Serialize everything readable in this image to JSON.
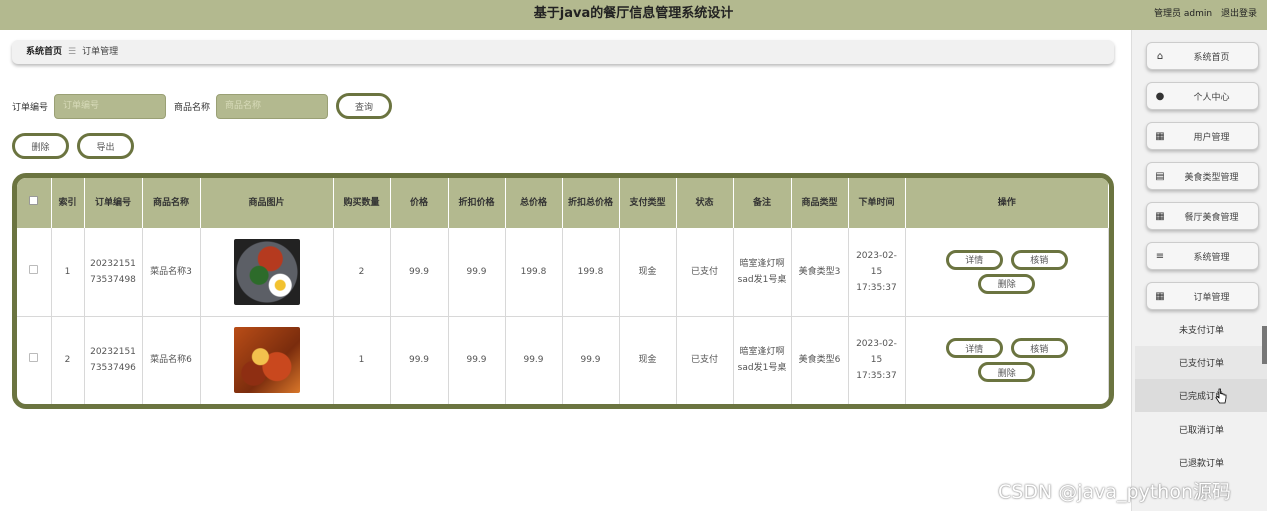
{
  "header": {
    "title": "基于java的餐厅信息管理系统设计",
    "admin_label": "管理员 admin",
    "logout_label": "退出登录"
  },
  "breadcrumb": {
    "home": "系统首页",
    "current": "订单管理"
  },
  "search": {
    "order_no_label": "订单编号",
    "order_no_placeholder": "订单编号",
    "product_name_label": "商品名称",
    "product_name_placeholder": "商品名称",
    "query_button": "查询"
  },
  "actions": {
    "delete_button": "删除",
    "export_button": "导出"
  },
  "table": {
    "columns": [
      "索引",
      "订单编号",
      "商品名称",
      "商品图片",
      "购买数量",
      "价格",
      "折扣价格",
      "总价格",
      "折扣总价格",
      "支付类型",
      "状态",
      "备注",
      "商品类型",
      "下单时间",
      "操作"
    ],
    "rows": [
      {
        "index": "1",
        "order_no": "2023215173537498",
        "product_name": "菜品名称3",
        "image_icon": "food-photo-icon",
        "quantity": "2",
        "price": "99.9",
        "discount_price": "99.9",
        "total_price": "199.8",
        "discount_total": "199.8",
        "pay_type": "现金",
        "status": "已支付",
        "remark": "暗室逢灯啊sad发1号桌",
        "product_type": "美食类型3",
        "order_time": "2023-02-15 17:35:37"
      },
      {
        "index": "2",
        "order_no": "2023215173537496",
        "product_name": "菜品名称6",
        "image_icon": "food-photo-icon",
        "quantity": "1",
        "price": "99.9",
        "discount_price": "99.9",
        "total_price": "99.9",
        "discount_total": "99.9",
        "pay_type": "现金",
        "status": "已支付",
        "remark": "暗室逢灯啊sad发1号桌",
        "product_type": "美食类型6",
        "order_time": "2023-02-15 17:35:37"
      }
    ],
    "row_actions": {
      "detail": "详情",
      "verify": "核销",
      "delete": "删除"
    }
  },
  "sidebar": {
    "items": [
      {
        "label": "系统首页",
        "icon": "home-icon"
      },
      {
        "label": "个人中心",
        "icon": "user-icon"
      },
      {
        "label": "用户管理",
        "icon": "grid-icon"
      },
      {
        "label": "美食类型管理",
        "icon": "clipboard-icon"
      },
      {
        "label": "餐厅美食管理",
        "icon": "grid-icon"
      },
      {
        "label": "系统管理",
        "icon": "list-icon"
      },
      {
        "label": "订单管理",
        "icon": "grid-icon"
      }
    ],
    "submenu": [
      {
        "label": "未支付订单"
      },
      {
        "label": "已支付订单"
      },
      {
        "label": "已完成订单"
      },
      {
        "label": "已取消订单"
      },
      {
        "label": "已退款订单"
      }
    ]
  },
  "watermark": "CSDN @java_python源码",
  "colors": {
    "accent": "#b3b98f",
    "accent_dark": "#6b7440",
    "sidebar_bg": "#f1f1f1"
  }
}
